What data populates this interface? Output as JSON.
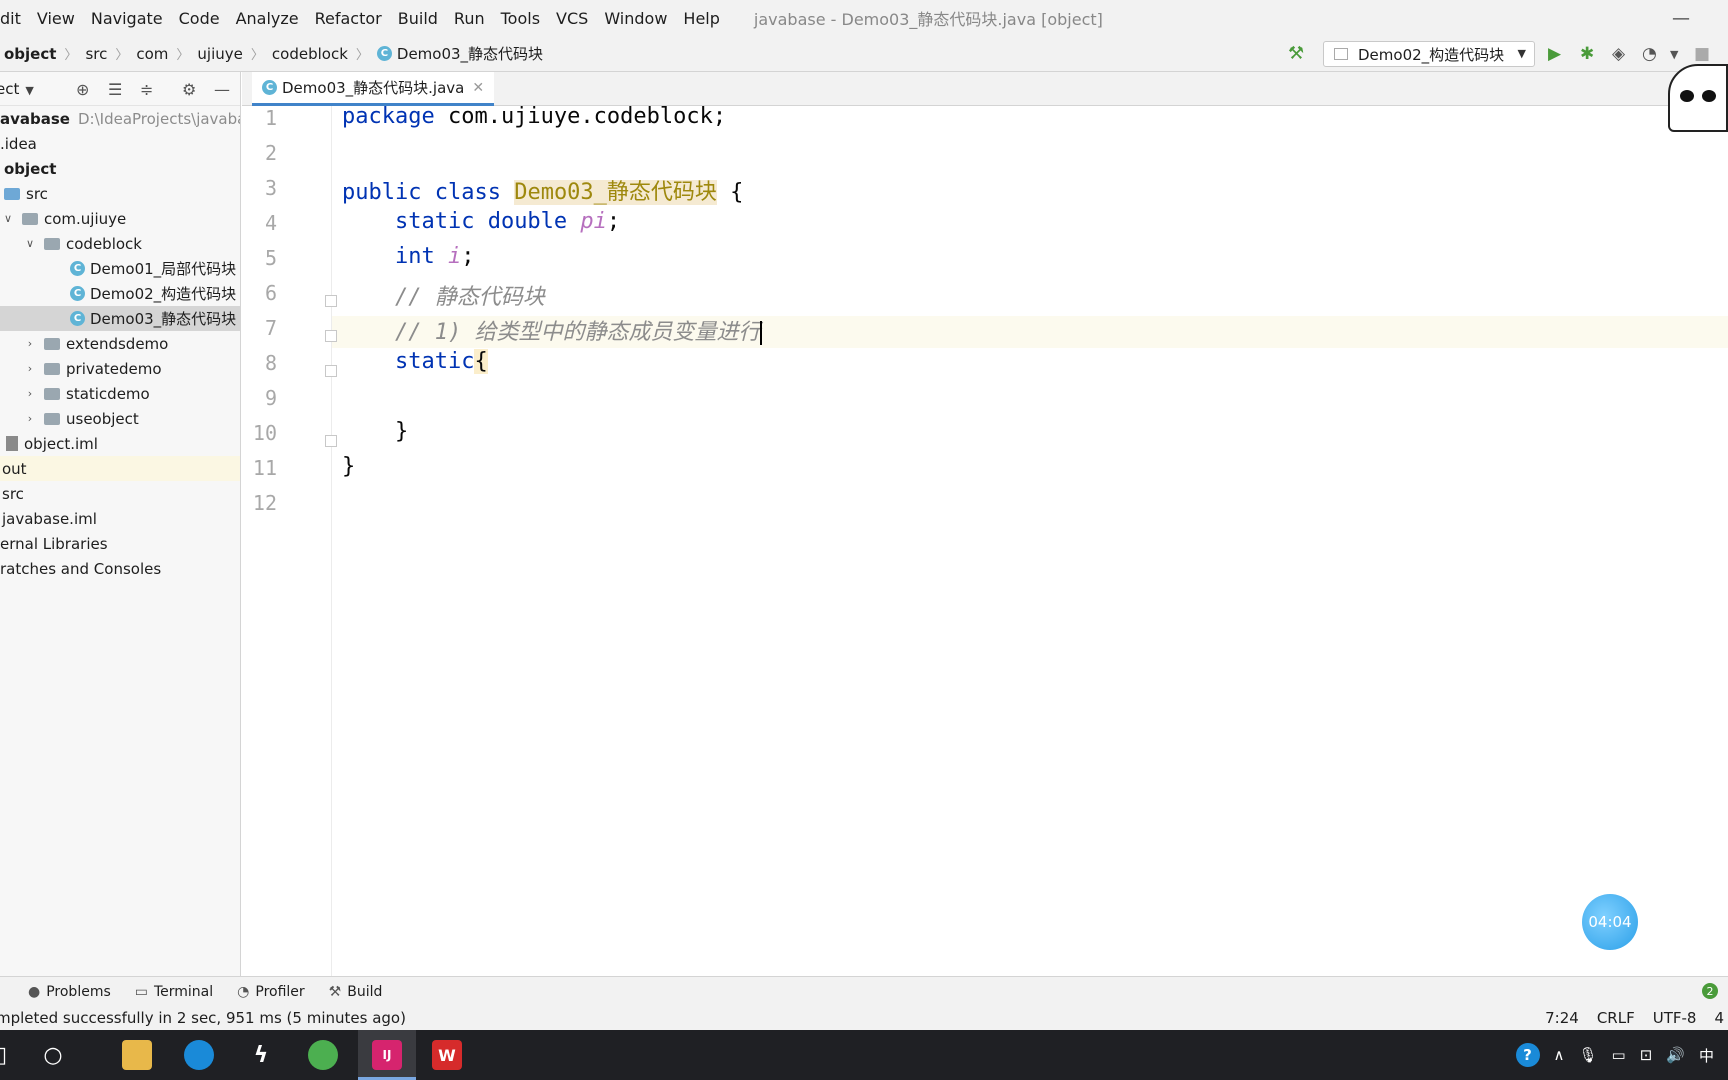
{
  "menu": {
    "items": [
      "dit",
      "View",
      "Navigate",
      "Code",
      "Analyze",
      "Refactor",
      "Build",
      "Run",
      "Tools",
      "VCS",
      "Window",
      "Help"
    ],
    "window_title": "javabase - Demo03_静态代码块.java [object]"
  },
  "breadcrumb": {
    "items": [
      "object",
      "src",
      "com",
      "ujiuye",
      "codeblock",
      "Demo03_静态代码块"
    ]
  },
  "run_config": {
    "label": "Demo02_构造代码块"
  },
  "sidebar": {
    "title": "ect",
    "project_root": "avabase",
    "project_path": "D:\\IdeaProjects\\javabase",
    "rows": [
      ".idea",
      "object",
      "src",
      "com.ujiuye",
      "codeblock",
      "Demo01_局部代码块",
      "Demo02_构造代码块",
      "Demo03_静态代码块",
      "extendsdemo",
      "privatedemo",
      "staticdemo",
      "useobject",
      "object.iml",
      "out",
      "src",
      "javabase.iml",
      "ernal Libraries",
      "ratches and Consoles"
    ]
  },
  "editor": {
    "tab_label": "Demo03_静态代码块.java",
    "line_numbers": [
      "1",
      "2",
      "3",
      "4",
      "5",
      "6",
      "7",
      "8",
      "9",
      "10",
      "11",
      "12"
    ],
    "code": {
      "l1_kw": "package",
      "l1_rest": " com.ujiuye.codeblock;",
      "l3_kw": "public class",
      "l3_cls": "Demo03_静态代码块",
      "l3_rest": " {",
      "l4_kw": "static double",
      "l4_field": "pi",
      "l4_end": ";",
      "l5_kw": "int",
      "l5_field": "i",
      "l5_end": ";",
      "l6_comment": "// 静态代码块",
      "l7_comment": "// 1) 给类型中的静态成员变量进行",
      "l8_kw": "static",
      "l8_brace": "{",
      "l10": "}",
      "l11": "}"
    }
  },
  "timer": {
    "label": "04:04"
  },
  "toolwindows": [
    "Problems",
    "Terminal",
    "Profiler",
    "Build"
  ],
  "status": {
    "message": "mpleted successfully in 2 sec, 951 ms (5 minutes ago)",
    "position": "7:24",
    "line_sep": "CRLF",
    "encoding": "UTF-8",
    "indent": "4",
    "event_badge": "2"
  },
  "taskbar": {
    "tray_lang": "中"
  },
  "colors": {
    "keyword": "#0033b3",
    "class_highlight": "#f5ead2",
    "comment": "#8c8c8c",
    "tab_underline": "#4083c9"
  }
}
